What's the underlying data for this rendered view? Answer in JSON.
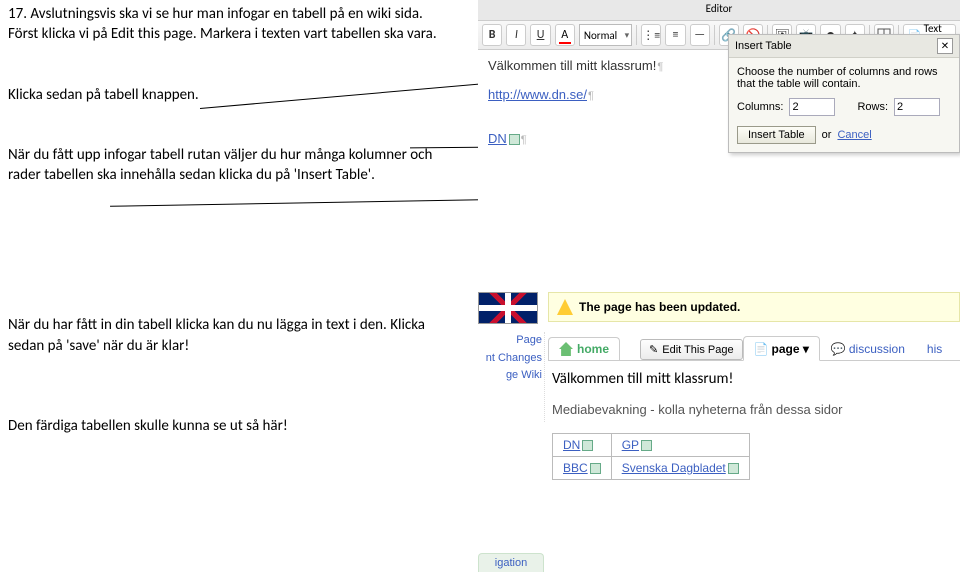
{
  "instructions": {
    "step17": "17. Avslutningsvis ska vi se hur man infogar en tabell på en wiki sida. Först klicka vi på Edit this page. Markera i texten vart tabellen ska vara.",
    "clickTable": "Klicka sedan på tabell knappen.",
    "chooseColsRows": "När du fått upp infogar tabell rutan väljer du hur många kolumner och rader tabellen ska innehålla sedan klicka du på 'Insert Table'.",
    "afterInsert": "När du har fått in din tabell klicka kan du nu lägga in text i den. Klicka sedan på 'save' när du är klar!",
    "finished": "Den färdiga tabellen skulle kunna se ut så här!"
  },
  "editor": {
    "title": "Editor",
    "bold": "B",
    "italic": "I",
    "underline": "U",
    "styleSelect": "Normal",
    "textEdBtn": "Text Ed",
    "content": {
      "welcome": "Välkommen till mitt klassrum!",
      "link1": "http://www.dn.se/",
      "link2": "DN"
    }
  },
  "popup": {
    "title": "Insert Table",
    "desc": "Choose the number of columns and rows that the table will contain.",
    "colsLabel": "Columns:",
    "colsVal": "2",
    "rowsLabel": "Rows:",
    "rowsVal": "2",
    "insertBtn": "Insert Table",
    "or": "or",
    "cancel": "Cancel"
  },
  "wiki": {
    "alert": "The page has been updated.",
    "home": "home",
    "editBtn": "Edit This Page",
    "tabPage": "page",
    "tabDiscussion": "discussion",
    "tabHistory": "his",
    "sidebar": {
      "l1": "Page",
      "l2": "nt Changes",
      "l3": "ge Wiki"
    },
    "content": {
      "heading": "Välkommen till mitt klassrum!",
      "sub": "Mediabevakning - kolla nyheterna från dessa sidor",
      "table": [
        [
          "DN",
          "GP"
        ],
        [
          "BBC",
          "Svenska Dagbladet"
        ]
      ]
    },
    "footerTab": "igation"
  }
}
